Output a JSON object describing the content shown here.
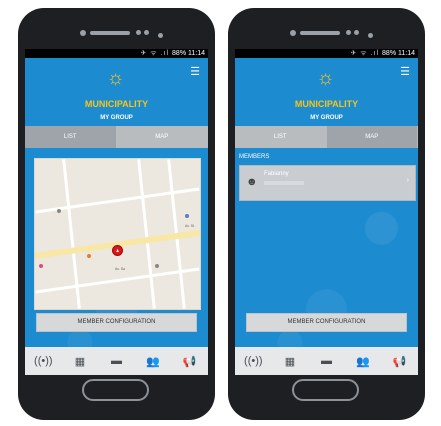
{
  "status": {
    "icons": "✈ ᯤ .ıl",
    "battery": "88%",
    "time": "11:14"
  },
  "header": {
    "logo_glyph": "☼",
    "brand": "MUNICIPALITY",
    "subtitle": "MY GROUP",
    "menu_icon": "menu-icon"
  },
  "left": {
    "tabs": [
      {
        "label": "LIST",
        "active": false
      },
      {
        "label": "MAP",
        "active": true
      }
    ],
    "config_label": "MEMBER CONFIGURATION",
    "map_labels": [
      "Av. St",
      "Av. Sa"
    ]
  },
  "right": {
    "tabs": [
      {
        "label": "LIST",
        "active": true
      },
      {
        "label": "MAP",
        "active": false
      }
    ],
    "members_label": "MEMBERS",
    "members": [
      {
        "name": "Fabianny"
      }
    ],
    "config_label": "MEMBER CONFIGURATION"
  },
  "nav": [
    {
      "name": "broadcast-icon",
      "glyph": "((•))"
    },
    {
      "name": "calculator-icon",
      "glyph": "▦"
    },
    {
      "name": "car-icon",
      "glyph": "▬"
    },
    {
      "name": "group-icon",
      "glyph": "👥"
    },
    {
      "name": "megaphone-icon",
      "glyph": "📢"
    }
  ],
  "colors": {
    "screen_blue": "#1d8bd0",
    "brand_yellow": "#f5c518",
    "pin_red": "#d41a1a"
  }
}
